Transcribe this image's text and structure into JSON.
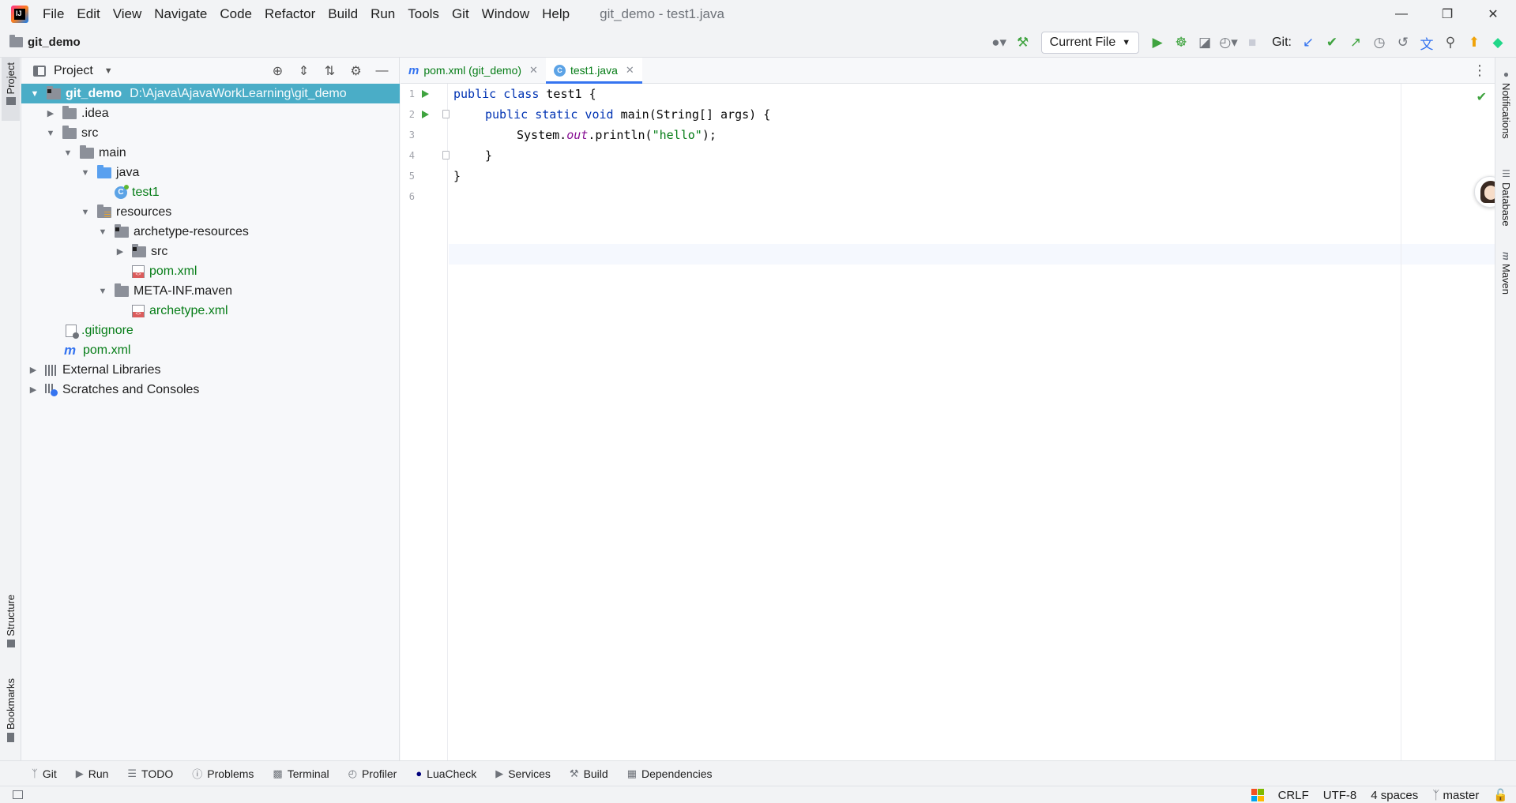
{
  "app": {
    "window_title": "git_demo - test1.java",
    "menu": [
      "File",
      "Edit",
      "View",
      "Navigate",
      "Code",
      "Refactor",
      "Build",
      "Run",
      "Tools",
      "Git",
      "Window",
      "Help"
    ]
  },
  "toolbar": {
    "project_name": "git_demo",
    "run_config": "Current File",
    "git_label": "Git:"
  },
  "left_strip": {
    "project": "Project",
    "structure": "Structure",
    "bookmarks": "Bookmarks"
  },
  "right_strip": {
    "notifications": "Notifications",
    "database": "Database",
    "maven": "Maven"
  },
  "project_panel": {
    "title": "Project",
    "tree": [
      {
        "label": "git_demo",
        "hint": "D:\\Ajava\\AjavaWorkLearning\\git_demo"
      },
      {
        "label": ".idea"
      },
      {
        "label": "src"
      },
      {
        "label": "main"
      },
      {
        "label": "java"
      },
      {
        "label": "test1"
      },
      {
        "label": "resources"
      },
      {
        "label": "archetype-resources"
      },
      {
        "label": "src"
      },
      {
        "label": "pom.xml"
      },
      {
        "label": "META-INF.maven"
      },
      {
        "label": "archetype.xml"
      },
      {
        "label": ".gitignore"
      },
      {
        "label": "pom.xml"
      },
      {
        "label": "External Libraries"
      },
      {
        "label": "Scratches and Consoles"
      }
    ]
  },
  "editor": {
    "tabs": [
      {
        "label": "pom.xml (git_demo)",
        "active": false
      },
      {
        "label": "test1.java",
        "active": true
      }
    ],
    "line_numbers": [
      "1",
      "2",
      "3",
      "4",
      "5",
      "6"
    ],
    "code": {
      "l1_kw": "public class",
      "l1_rest": " test1 {",
      "l2_kw": "public static void",
      "l2_rest": " main(String[] args) {",
      "l3_a": "System.",
      "l3_field": "out",
      "l3_b": ".println(",
      "l3_str": "\"hello\"",
      "l3_c": ");",
      "l4": "}",
      "l5": "}"
    }
  },
  "bottom_tools": [
    "Git",
    "Run",
    "TODO",
    "Problems",
    "Terminal",
    "Profiler",
    "LuaCheck",
    "Services",
    "Build",
    "Dependencies"
  ],
  "status": {
    "line_sep": "CRLF",
    "encoding": "UTF-8",
    "indent": "4 spaces",
    "branch": "master"
  }
}
